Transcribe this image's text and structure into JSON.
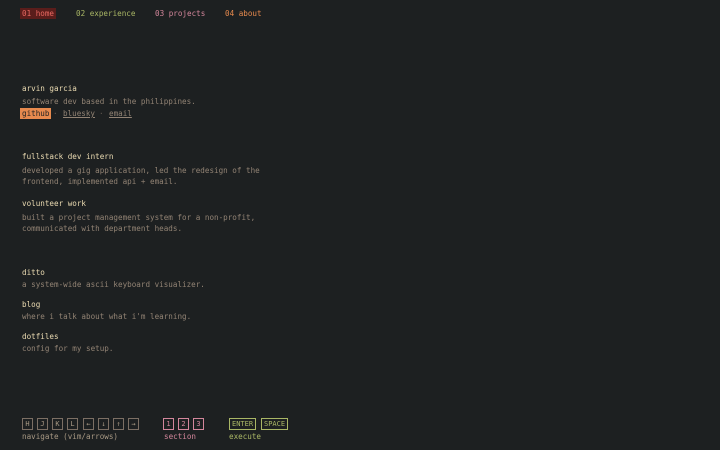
{
  "nav": {
    "items": [
      {
        "label": "01 home"
      },
      {
        "label": "02 experience"
      },
      {
        "label": "03 projects"
      },
      {
        "label": "04 about"
      }
    ]
  },
  "profile": {
    "name": "arvin garcia",
    "tagline": "software dev based in the philippines.",
    "links": [
      "github",
      "bluesky",
      "email"
    ],
    "separator": "·"
  },
  "experience": [
    {
      "title": "fullstack dev intern",
      "lines": [
        "developed a gig application, led the redesign of the",
        "frontend, implemented api + email."
      ]
    },
    {
      "title": "volunteer work",
      "lines": [
        "built a project management system for a non-profit,",
        "communicated with department heads."
      ]
    }
  ],
  "projects": [
    {
      "title": "ditto",
      "desc": "a system-wide ascii keyboard visualizer."
    },
    {
      "title": "blog",
      "desc": "where i talk about what i'm learning."
    },
    {
      "title": "dotfiles",
      "desc": "config for my setup."
    }
  ],
  "keys": {
    "navigate": {
      "keys": [
        "H",
        "J",
        "K",
        "L",
        "←",
        "↓",
        "↑",
        "→"
      ],
      "label": "navigate (vim/arrows)"
    },
    "section": {
      "keys": [
        "1",
        "2",
        "3"
      ],
      "label": "section"
    },
    "execute": {
      "keys": [
        "ENTER",
        "SPACE"
      ],
      "label": "execute"
    }
  },
  "colors": {
    "background": "#1d2021",
    "accent_orange": "#e78a4e",
    "accent_green": "#a9b665",
    "accent_pink": "#d3869b",
    "accent_red": "#ea6962"
  }
}
